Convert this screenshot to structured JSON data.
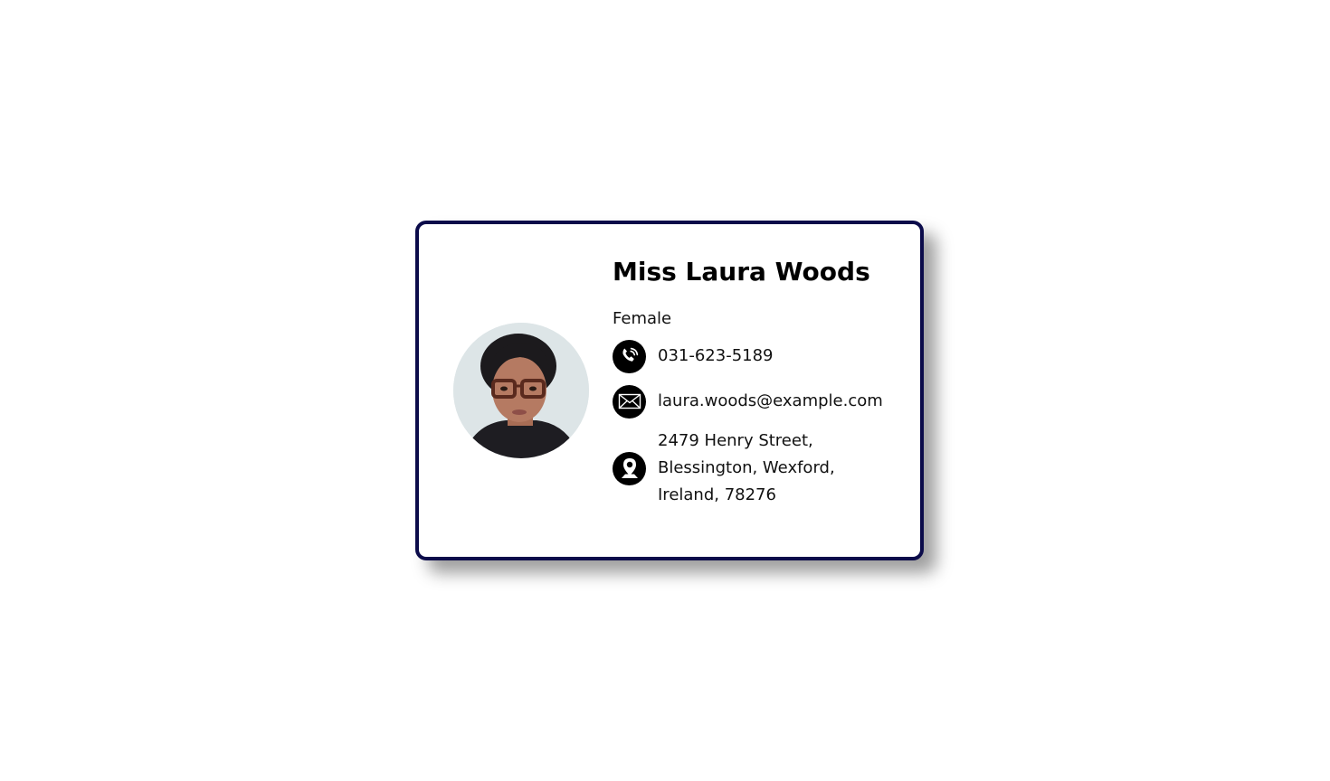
{
  "profile": {
    "name": "Miss Laura Woods",
    "gender": "Female",
    "phone": "031-623-5189",
    "email": "laura.woods@example.com",
    "address_lines": [
      "2479 Henry Street,",
      "Blessington, Wexford,",
      "Ireland, 78276"
    ]
  },
  "icons": {
    "phone": "phone-icon",
    "email": "envelope-icon",
    "address": "map-pin-icon"
  },
  "colors": {
    "card_border": "#0b0b4a",
    "icon_background": "#000000",
    "text": "#111111"
  }
}
